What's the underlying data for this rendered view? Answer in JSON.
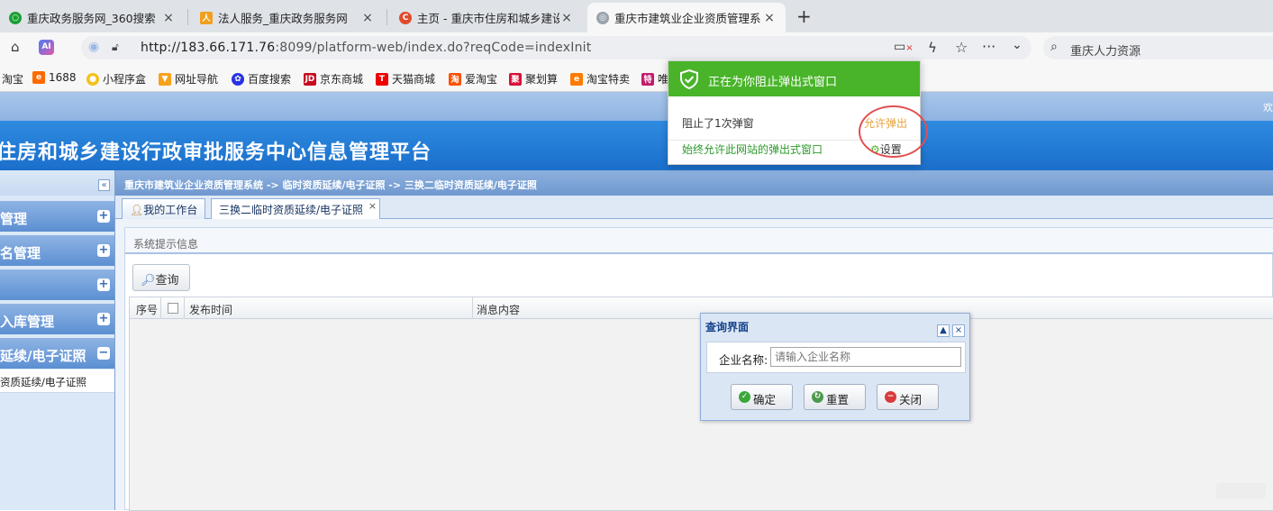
{
  "browser": {
    "tabs": [
      {
        "title": "重庆政务服务网_360搜索",
        "active": false
      },
      {
        "title": "法人服务_重庆政务服务网",
        "active": false
      },
      {
        "title": "主页 - 重庆市住房和城乡建设委",
        "active": false
      },
      {
        "title": "重庆市建筑业企业资质管理系",
        "active": true
      }
    ],
    "url": {
      "host": "http://183.66.171.76",
      "rest": ":8099/platform-web/index.do?reqCode=indexInit"
    },
    "search_text": "重庆人力资源",
    "bookmarks": [
      "淘宝",
      "1688",
      "小程序盒",
      "网址导航",
      "百度搜索",
      "京东商城",
      "天猫商城",
      "爱淘宝",
      "聚划算",
      "淘宝特卖",
      "唯"
    ],
    "accent": "#49b42a"
  },
  "popup_blocker": {
    "title": "正在为你阻止弹出式窗口",
    "blocked_text": "阻止了1次弹窗",
    "allow_label": "允许弹出",
    "always_allow_label": "始终允许此网站的弹出式窗口",
    "settings_label": "设置"
  },
  "app": {
    "header_top_right": "欢",
    "title": "住房和城乡建设行政审批服务中心信息管理平台",
    "breadcrumb": "重庆市建筑业企业资质管理系统 -> 临时资质延续/电子证照 -> 三换二临时资质延续/电子证照",
    "sidebar": {
      "collapse_icon": "«",
      "menus": [
        {
          "label": "管理",
          "sign": "+"
        },
        {
          "label": "名管理",
          "sign": "+"
        },
        {
          "label": "",
          "sign": "+"
        },
        {
          "label": "入库管理",
          "sign": "+"
        },
        {
          "label": "延续/电子证照",
          "sign": "−"
        }
      ],
      "subitem": "资质延续/电子证照"
    },
    "tabs": [
      {
        "label": "我的工作台",
        "icon": "user-icon"
      },
      {
        "label": "三换二临时资质延续/电子证照",
        "close": "×"
      }
    ],
    "panel_title": "系统提示信息",
    "query_button": "查询",
    "grid_columns": [
      "序号",
      "发布时间",
      "消息内容"
    ]
  },
  "dialog": {
    "title": "查询界面",
    "field_label": "企业名称:",
    "field_placeholder": "请输入企业名称",
    "buttons": {
      "ok": "确定",
      "reset": "重置",
      "close": "关闭"
    }
  }
}
